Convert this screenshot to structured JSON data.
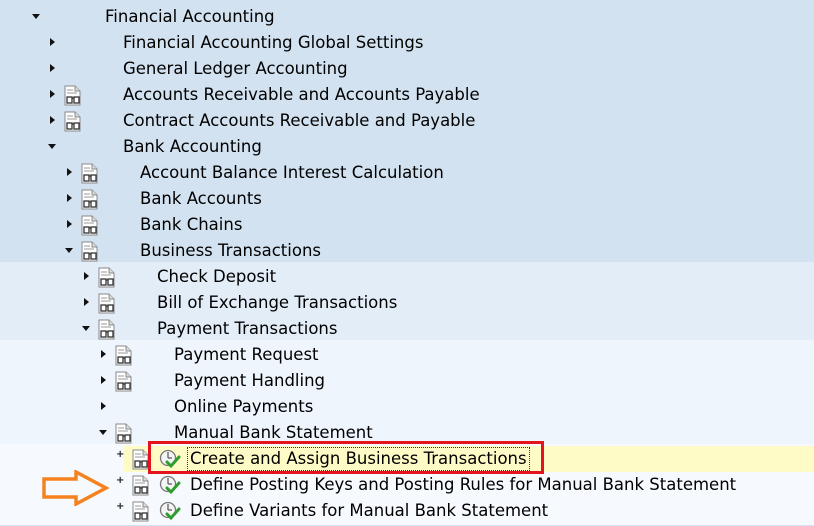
{
  "tree": {
    "rows": [
      {
        "label": "Financial Accounting",
        "state": "expanded",
        "doc_icon": false,
        "exec_icon": false
      },
      {
        "label": "Financial Accounting Global Settings",
        "state": "collapsed",
        "doc_icon": false,
        "exec_icon": false
      },
      {
        "label": "General Ledger Accounting",
        "state": "collapsed",
        "doc_icon": false,
        "exec_icon": false
      },
      {
        "label": "Accounts Receivable and Accounts Payable",
        "state": "collapsed",
        "doc_icon": true,
        "exec_icon": false
      },
      {
        "label": "Contract Accounts Receivable and Payable",
        "state": "collapsed",
        "doc_icon": true,
        "exec_icon": false
      },
      {
        "label": "Bank Accounting",
        "state": "expanded",
        "doc_icon": false,
        "exec_icon": false
      },
      {
        "label": "Account Balance Interest Calculation",
        "state": "collapsed",
        "doc_icon": true,
        "exec_icon": false
      },
      {
        "label": "Bank Accounts",
        "state": "collapsed",
        "doc_icon": true,
        "exec_icon": false
      },
      {
        "label": "Bank Chains",
        "state": "collapsed",
        "doc_icon": true,
        "exec_icon": false
      },
      {
        "label": "Business Transactions",
        "state": "expanded",
        "doc_icon": true,
        "exec_icon": false
      },
      {
        "label": "Check Deposit",
        "state": "collapsed",
        "doc_icon": true,
        "exec_icon": false
      },
      {
        "label": "Bill of Exchange Transactions",
        "state": "collapsed",
        "doc_icon": true,
        "exec_icon": false
      },
      {
        "label": "Payment Transactions",
        "state": "expanded",
        "doc_icon": true,
        "exec_icon": false
      },
      {
        "label": "Payment Request",
        "state": "collapsed",
        "doc_icon": true,
        "exec_icon": false
      },
      {
        "label": "Payment Handling",
        "state": "collapsed",
        "doc_icon": true,
        "exec_icon": false
      },
      {
        "label": "Online Payments",
        "state": "collapsed",
        "doc_icon": false,
        "exec_icon": false
      },
      {
        "label": "Manual Bank Statement",
        "state": "expanded",
        "doc_icon": true,
        "exec_icon": false
      },
      {
        "label": "Create and Assign Business Transactions",
        "state": "leaf",
        "doc_icon": true,
        "exec_icon": true,
        "selected": true
      },
      {
        "label": "Define Posting Keys and Posting Rules for Manual Bank Statement",
        "state": "leaf",
        "doc_icon": true,
        "exec_icon": true
      },
      {
        "label": "Define Variants for Manual Bank Statement",
        "state": "leaf",
        "doc_icon": true,
        "exec_icon": true
      }
    ]
  },
  "annotations": {
    "highlight_box_color": "#e3141e",
    "pointer_arrow_color": "#f58220"
  },
  "colors": {
    "level_bg_1": "#d3e2f0",
    "level_bg_2": "#e2edf8",
    "level_bg_3": "#eef5fd",
    "level_bg_4": "#f6f9fe",
    "selected_bg": "#fffbc6"
  }
}
